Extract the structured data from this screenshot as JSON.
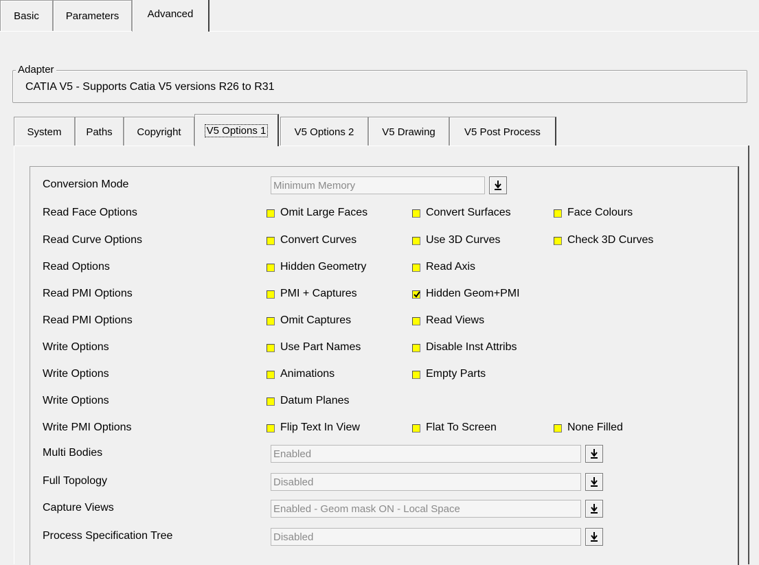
{
  "top_tabs": [
    {
      "label": "Basic",
      "active": false
    },
    {
      "label": "Parameters",
      "active": false
    },
    {
      "label": "Advanced",
      "active": true
    }
  ],
  "adapter": {
    "legend": "Adapter",
    "text": "CATIA V5  -  Supports Catia V5 versions R26 to R31"
  },
  "sub_tabs": [
    {
      "label": "System",
      "active": false
    },
    {
      "label": "Paths",
      "active": false
    },
    {
      "label": "Copyright",
      "active": false
    },
    {
      "label": "V5 Options 1",
      "active": true
    },
    {
      "label": "V5 Options 2",
      "active": false
    },
    {
      "label": "V5 Drawing",
      "active": false
    },
    {
      "label": "V5 Post Process",
      "active": false
    }
  ],
  "options": {
    "checkbox_color": "#ffff00",
    "rows": [
      {
        "label": "Conversion Mode",
        "combo": "Minimum Memory"
      },
      {
        "label": "Read Face Options",
        "checks": [
          {
            "label": "Omit Large Faces",
            "checked": false
          },
          {
            "label": "Convert Surfaces",
            "checked": false
          },
          {
            "label": "Face Colours",
            "checked": false
          }
        ]
      },
      {
        "label": "Read Curve Options",
        "checks": [
          {
            "label": "Convert Curves",
            "checked": false
          },
          {
            "label": "Use 3D Curves",
            "checked": false
          },
          {
            "label": "Check 3D Curves",
            "checked": false
          }
        ]
      },
      {
        "label": "Read Options",
        "checks": [
          {
            "label": "Hidden Geometry",
            "checked": false
          },
          {
            "label": "Read Axis",
            "checked": false
          }
        ]
      },
      {
        "label": "Read PMI Options",
        "checks": [
          {
            "label": "PMI + Captures",
            "checked": false
          },
          {
            "label": "Hidden Geom+PMI",
            "checked": true
          }
        ]
      },
      {
        "label": "Read PMI Options",
        "checks": [
          {
            "label": "Omit Captures",
            "checked": false
          },
          {
            "label": "Read Views",
            "checked": false
          }
        ]
      },
      {
        "label": "Write Options",
        "checks": [
          {
            "label": "Use Part Names",
            "checked": false
          },
          {
            "label": "Disable Inst Attribs",
            "checked": false
          }
        ]
      },
      {
        "label": "Write Options",
        "checks": [
          {
            "label": "Animations",
            "checked": false
          },
          {
            "label": "Empty Parts",
            "checked": false
          }
        ]
      },
      {
        "label": "Write Options",
        "checks": [
          {
            "label": "Datum Planes",
            "checked": false
          }
        ]
      },
      {
        "label": "Write PMI Options",
        "checks": [
          {
            "label": "Flip Text In View",
            "checked": false
          },
          {
            "label": "Flat To Screen",
            "checked": false
          },
          {
            "label": "None Filled",
            "checked": false
          }
        ]
      },
      {
        "label": "Multi Bodies",
        "combo": "Enabled"
      },
      {
        "label": "Full Topology",
        "combo": "Disabled"
      },
      {
        "label": "Capture Views",
        "combo": "Enabled - Geom mask ON  -  Local Space"
      },
      {
        "label": "Process Specification Tree",
        "combo": "Disabled"
      }
    ]
  }
}
